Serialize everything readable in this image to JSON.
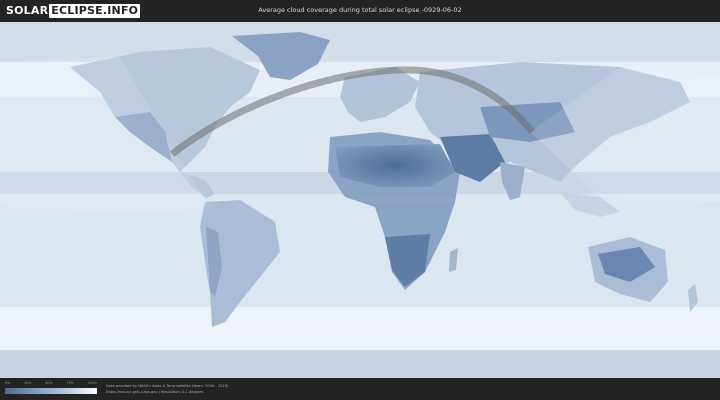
{
  "header": {
    "logo": {
      "part_a": "SOLAR",
      "part_b": "ECLIPSE.INFO"
    },
    "title": "Average cloud coverage during total solar eclipse -0929-06-02"
  },
  "map": {
    "ocean_color": "#dce6f1",
    "dense_cloud_color": "#e9f0f7",
    "clear_sky_color": "#5a79a0",
    "eclipse_path_color": "#6d6d6d"
  },
  "legend": {
    "ticks": [
      "0%",
      "25%",
      "50%",
      "75%",
      "100%"
    ],
    "gradient": [
      "#4f6d93",
      "#7f9bbd",
      "#b5c8df",
      "#ffffff"
    ]
  },
  "credits": {
    "line1": "Data provided by NASA's Aqua & Terra satellite (Years: 2000 - 2019)",
    "line2": "https://neo.sci.gsfc.nasa.gov | Resolution: 0.1 degrees"
  }
}
